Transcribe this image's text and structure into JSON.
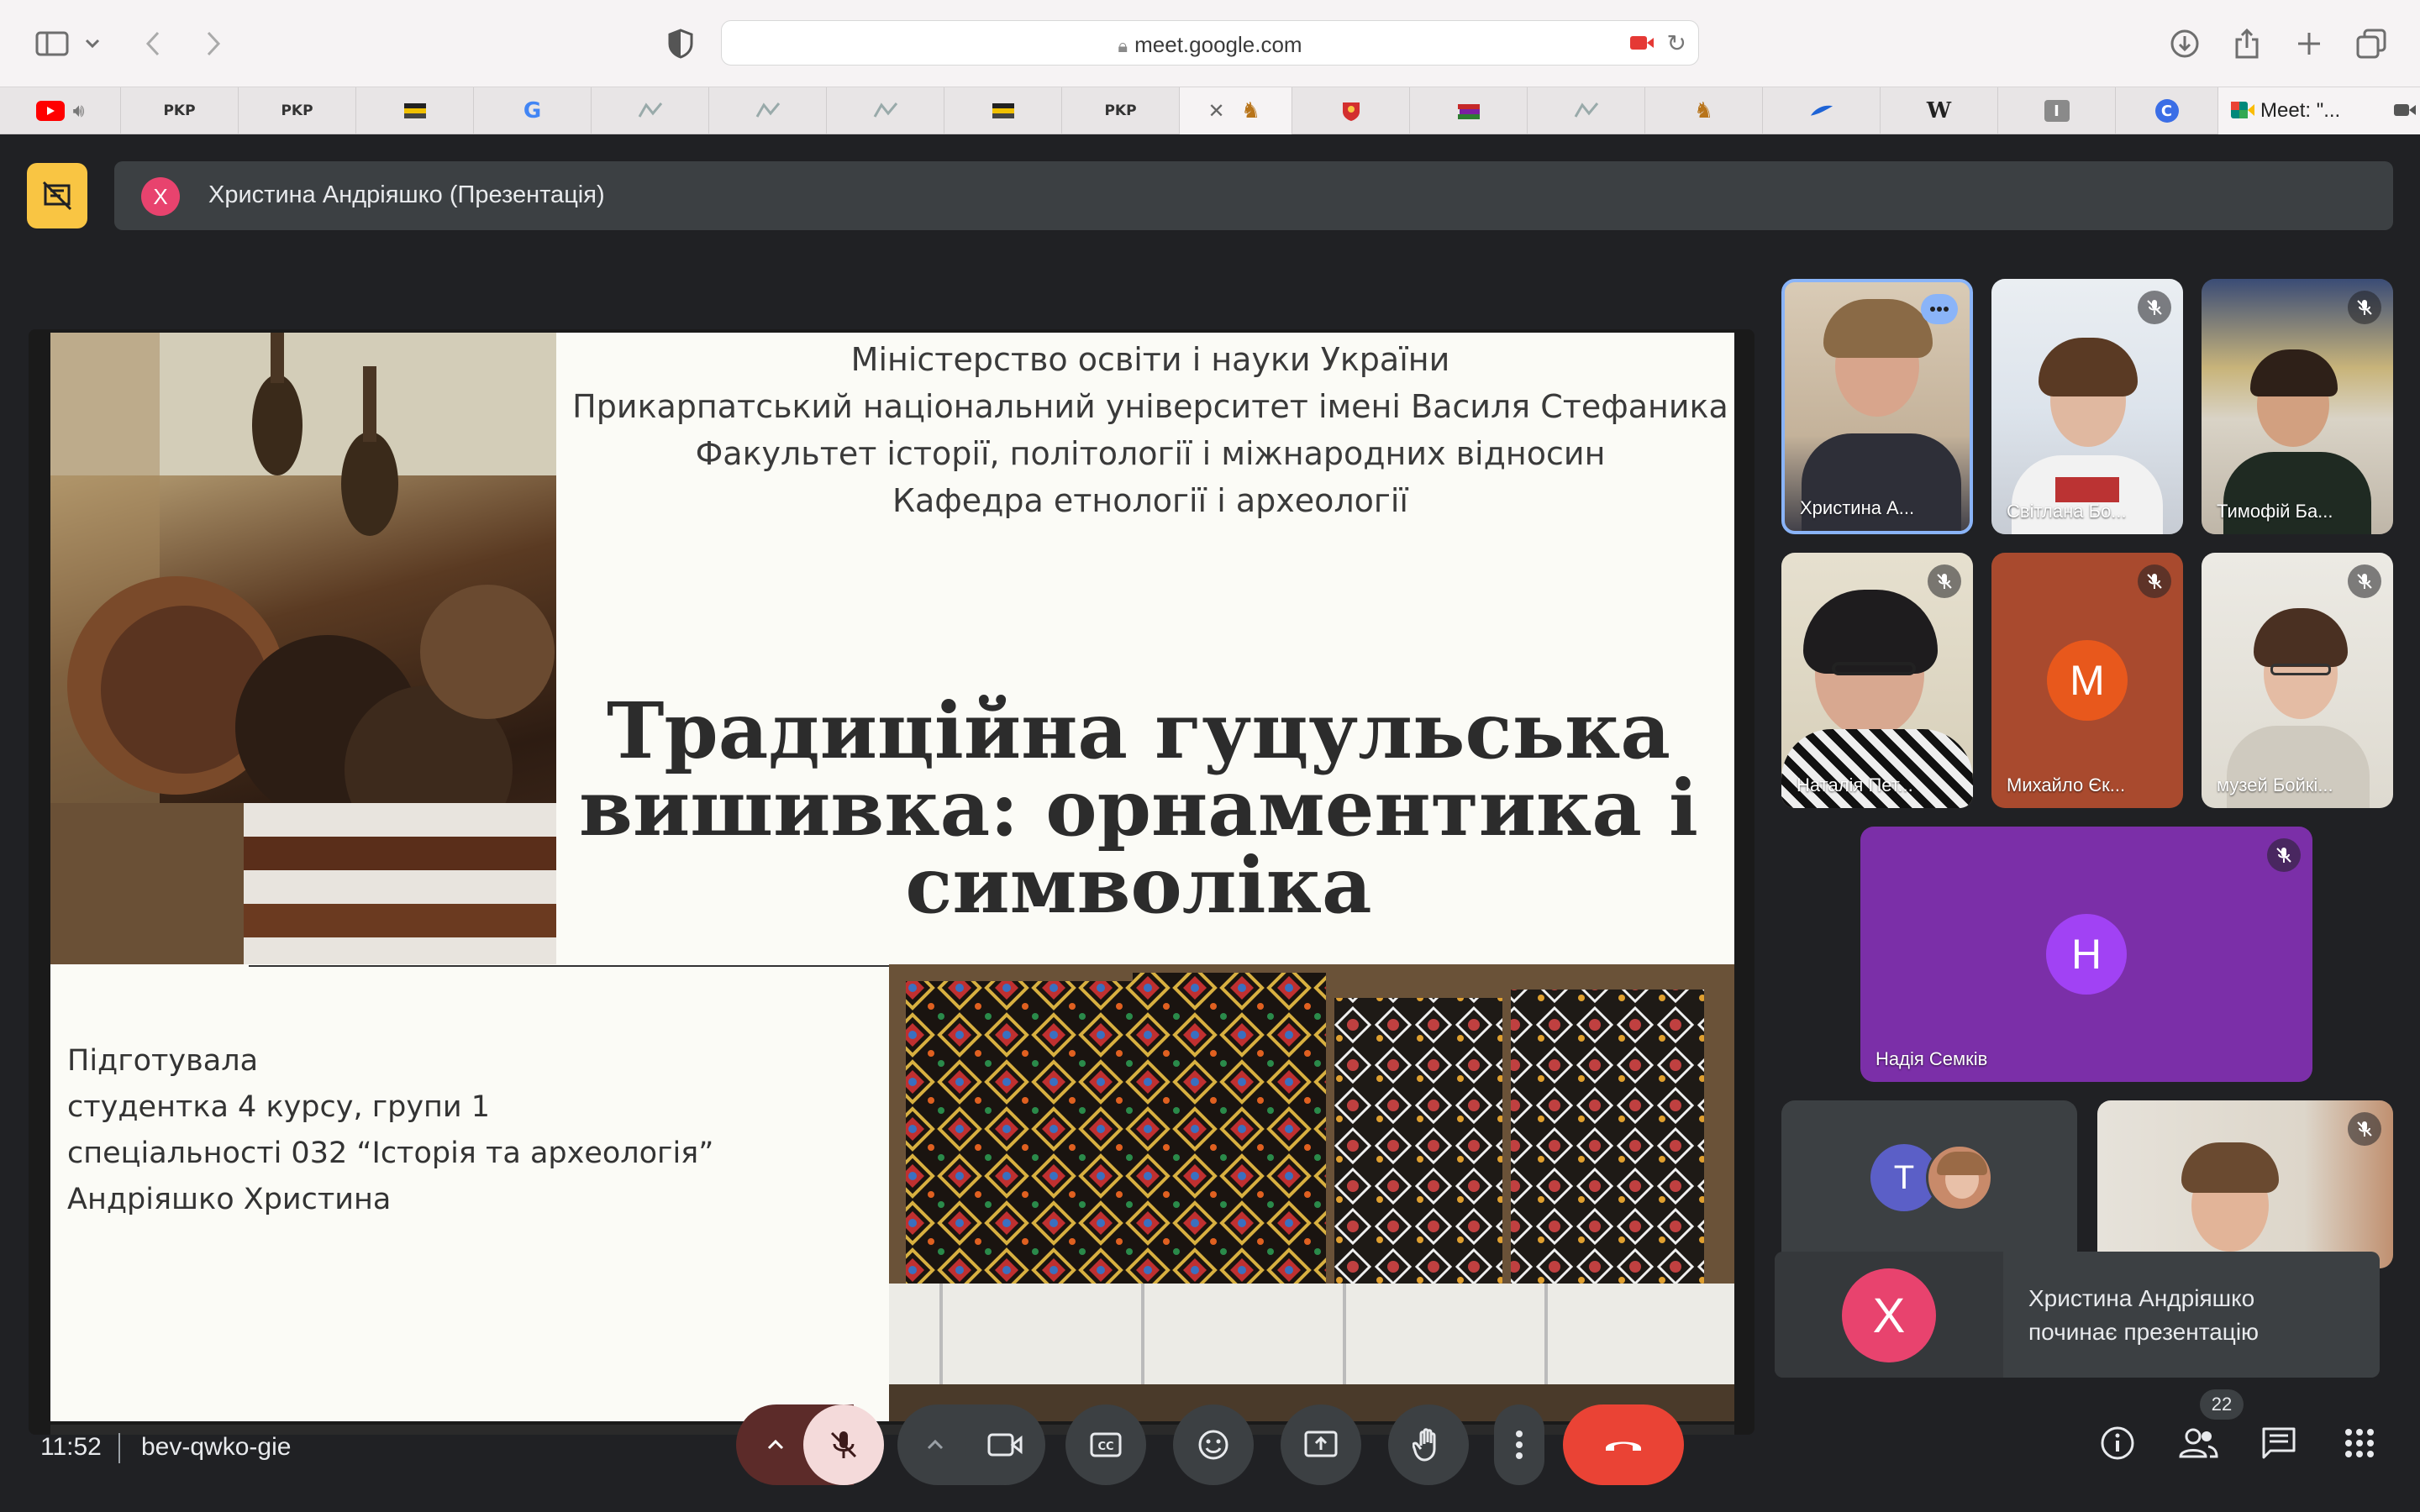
{
  "browser": {
    "url": "meet.google.com",
    "tabs": [
      {
        "label": "",
        "icon": "youtube-icon",
        "color": "#ff0000"
      },
      {
        "label": "PKP",
        "icon": "pkp-icon"
      },
      {
        "label": "PKP",
        "icon": "pkp-icon"
      },
      {
        "label": "",
        "icon": "flag-icon"
      },
      {
        "label": "G",
        "icon": "google-icon"
      },
      {
        "label": "",
        "icon": "map-icon"
      },
      {
        "label": "",
        "icon": "map-icon"
      },
      {
        "label": "",
        "icon": "map-icon"
      },
      {
        "label": "",
        "icon": "flag-icon"
      },
      {
        "label": "PKP",
        "icon": "pkp-icon"
      },
      {
        "label": "",
        "icon": "horse-rider-icon"
      },
      {
        "label": "",
        "icon": "coat-of-arms-icon"
      },
      {
        "label": "",
        "icon": "book-icon"
      },
      {
        "label": "",
        "icon": "map-icon"
      },
      {
        "label": "",
        "icon": "horse-rider-icon"
      },
      {
        "label": "",
        "icon": "swoosh-icon"
      },
      {
        "label": "W",
        "icon": "wikipedia-icon"
      },
      {
        "label": "I",
        "icon": "letter-i-icon"
      },
      {
        "label": "C",
        "icon": "circle-c-icon"
      }
    ],
    "meet_tab_label": "Meet: \"..."
  },
  "meet": {
    "presenter_initial": "Х",
    "presenter_label": "Христина Андріяшко (Презентація)",
    "time": "11:52",
    "meeting_code": "bev-qwko-gie",
    "participant_count": "22",
    "accent_yellow": "#f9c543",
    "leave_red": "#ea4335"
  },
  "slide": {
    "info_lines": [
      "Міністерство освіти і науки України",
      "Прикарпатський національний університет імені Василя Стефаника",
      "Факультет історії, політології і міжнародних відносин",
      "Кафедра етнології і археології"
    ],
    "title_lines": [
      "Традиційна гуцульська",
      "вишивка: орнаментика і",
      "символіка"
    ],
    "prep_lines": [
      "Підготувала",
      "студентка 4 курсу, групи 1",
      "спеціальності 032 “Історія та археологія”",
      "Андріяшко Христина"
    ]
  },
  "participants": [
    {
      "name": "Христина А...",
      "initial": "",
      "video": true
    },
    {
      "name": "Світлана Бо...",
      "initial": "",
      "video": true
    },
    {
      "name": "Тимофій Ба...",
      "initial": "",
      "video": true
    },
    {
      "name": "Наталія Пет...",
      "initial": "",
      "video": true
    },
    {
      "name": "Михайло Єк...",
      "initial": "М",
      "video": false,
      "color": "#e8581c"
    },
    {
      "name": "музей Бойкі...",
      "initial": "",
      "video": true
    },
    {
      "name": "Надія Семків",
      "initial": "Н",
      "video": false,
      "color": "#a142f4"
    },
    {
      "name": "",
      "initial": "Т",
      "video": false,
      "color": "#5b5fc7"
    },
    {
      "name": "",
      "initial": "",
      "video": true
    }
  ],
  "toast": {
    "initial": "Х",
    "line1": "Христина Андріяшко",
    "line2": "починає презентацію"
  }
}
